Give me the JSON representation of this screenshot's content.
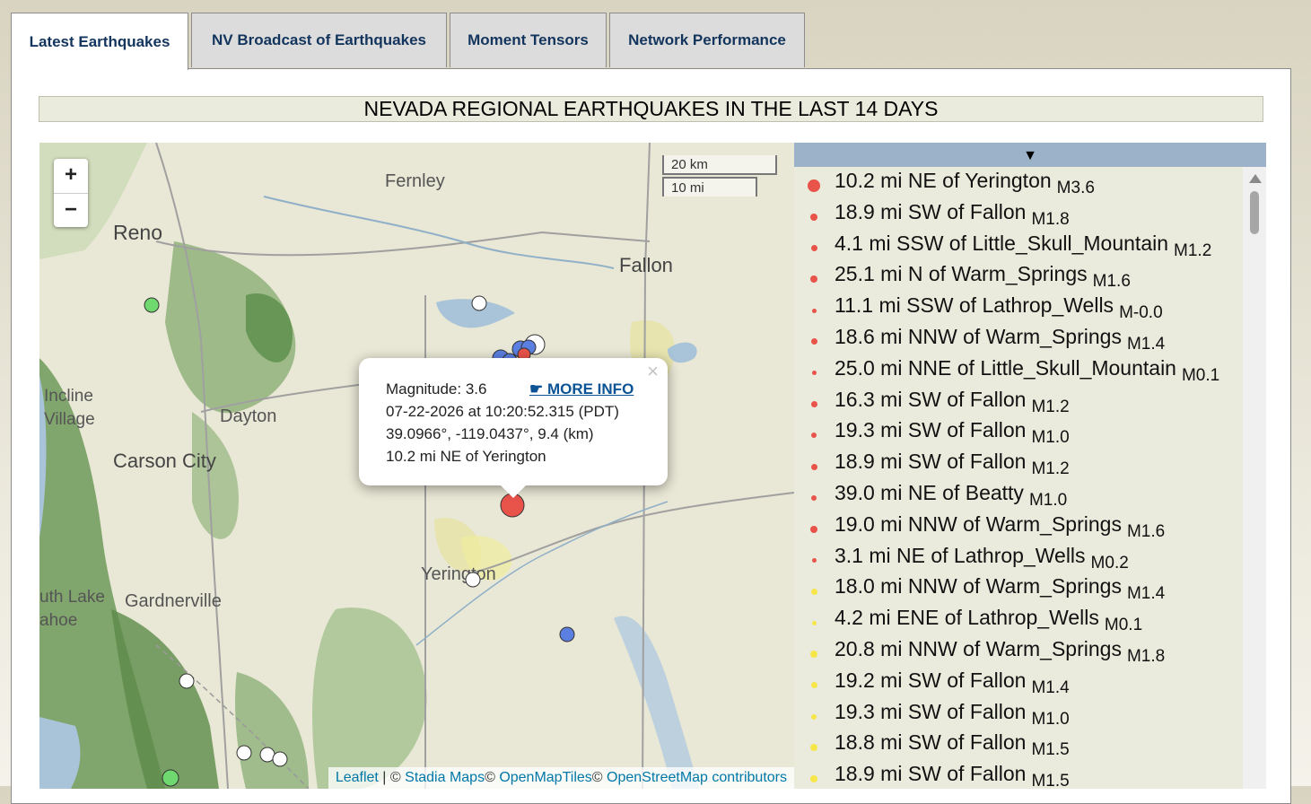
{
  "tabs": [
    {
      "label": "Latest Earthquakes",
      "active": true
    },
    {
      "label": "NV Broadcast of Earthquakes",
      "active": false
    },
    {
      "label": "Moment Tensors",
      "active": false
    },
    {
      "label": "Network Performance",
      "active": false
    }
  ],
  "title": "NEVADA REGIONAL EARTHQUAKES IN THE LAST 14 DAYS",
  "map": {
    "zoom_in": "+",
    "zoom_out": "−",
    "scale_km": "20 km",
    "scale_mi": "10 mi",
    "places": {
      "fernley": "Fernley",
      "reno": "Reno",
      "fallon": "Fallon",
      "incline1": "Incline",
      "incline2": "Village",
      "dayton": "Dayton",
      "carson": "Carson City",
      "yerington": "Yerington",
      "tahoe1": "uth Lake",
      "tahoe2": "ahoe",
      "gardnerville": "Gardnerville"
    },
    "popup": {
      "magnitude": "Magnitude: 3.6",
      "more_info": "☛ MORE INFO",
      "datetime": "07-22-2026 at 10:20:52.315 (PDT)",
      "location": "39.0966°, -119.0437°, 9.4 (km)",
      "place": "10.2 mi NE of Yerington",
      "close": "×"
    },
    "attribution": {
      "leaflet": "Leaflet",
      "sep": " | © ",
      "stadia": "Stadia Maps",
      "c1": "© ",
      "omt": "OpenMapTiles",
      "c2": "© ",
      "osm": "OpenStreetMap contributors"
    },
    "colors": {
      "recent": "#e8534a",
      "day": "#5b7fe0",
      "week": "#ffffff",
      "old": "#6fd96f"
    }
  },
  "list": {
    "header_arrow": "▼",
    "items": [
      {
        "place": "10.2 mi NE of Yerington",
        "mag": "M3.6",
        "color": "#e8534a",
        "size": 14
      },
      {
        "place": "18.9 mi SW of Fallon",
        "mag": "M1.8",
        "color": "#e8534a",
        "size": 8
      },
      {
        "place": "4.1 mi SSW of Little_Skull_Mountain",
        "mag": "M1.2",
        "color": "#e8534a",
        "size": 7
      },
      {
        "place": "25.1 mi N of Warm_Springs",
        "mag": "M1.6",
        "color": "#e8534a",
        "size": 8
      },
      {
        "place": "11.1 mi SSW of Lathrop_Wells",
        "mag": "M-0.0",
        "color": "#e8534a",
        "size": 5
      },
      {
        "place": "18.6 mi NNW of Warm_Springs",
        "mag": "M1.4",
        "color": "#e8534a",
        "size": 7
      },
      {
        "place": "25.0 mi NNE of Little_Skull_Mountain",
        "mag": "M0.1",
        "color": "#e8534a",
        "size": 5
      },
      {
        "place": "16.3 mi SW of Fallon",
        "mag": "M1.2",
        "color": "#e8534a",
        "size": 7
      },
      {
        "place": "19.3 mi SW of Fallon",
        "mag": "M1.0",
        "color": "#e8534a",
        "size": 6
      },
      {
        "place": "18.9 mi SW of Fallon",
        "mag": "M1.2",
        "color": "#e8534a",
        "size": 7
      },
      {
        "place": "39.0 mi NE of Beatty",
        "mag": "M1.0",
        "color": "#e8534a",
        "size": 6
      },
      {
        "place": "19.0 mi NNW of Warm_Springs",
        "mag": "M1.6",
        "color": "#e8534a",
        "size": 8
      },
      {
        "place": "3.1 mi NE of Lathrop_Wells",
        "mag": "M0.2",
        "color": "#e8534a",
        "size": 5
      },
      {
        "place": "18.0 mi NNW of Warm_Springs",
        "mag": "M1.4",
        "color": "#f7e64a",
        "size": 7
      },
      {
        "place": "4.2 mi ENE of Lathrop_Wells",
        "mag": "M0.1",
        "color": "#f7e64a",
        "size": 5
      },
      {
        "place": "20.8 mi NNW of Warm_Springs",
        "mag": "M1.8",
        "color": "#f7e64a",
        "size": 8
      },
      {
        "place": "19.2 mi SW of Fallon",
        "mag": "M1.4",
        "color": "#f7e64a",
        "size": 7
      },
      {
        "place": "19.3 mi SW of Fallon",
        "mag": "M1.0",
        "color": "#f7e64a",
        "size": 6
      },
      {
        "place": "18.8 mi SW of Fallon",
        "mag": "M1.5",
        "color": "#f7e64a",
        "size": 8
      },
      {
        "place": "18.9 mi SW of Fallon",
        "mag": "M1.5",
        "color": "#f7e64a",
        "size": 8
      }
    ]
  }
}
